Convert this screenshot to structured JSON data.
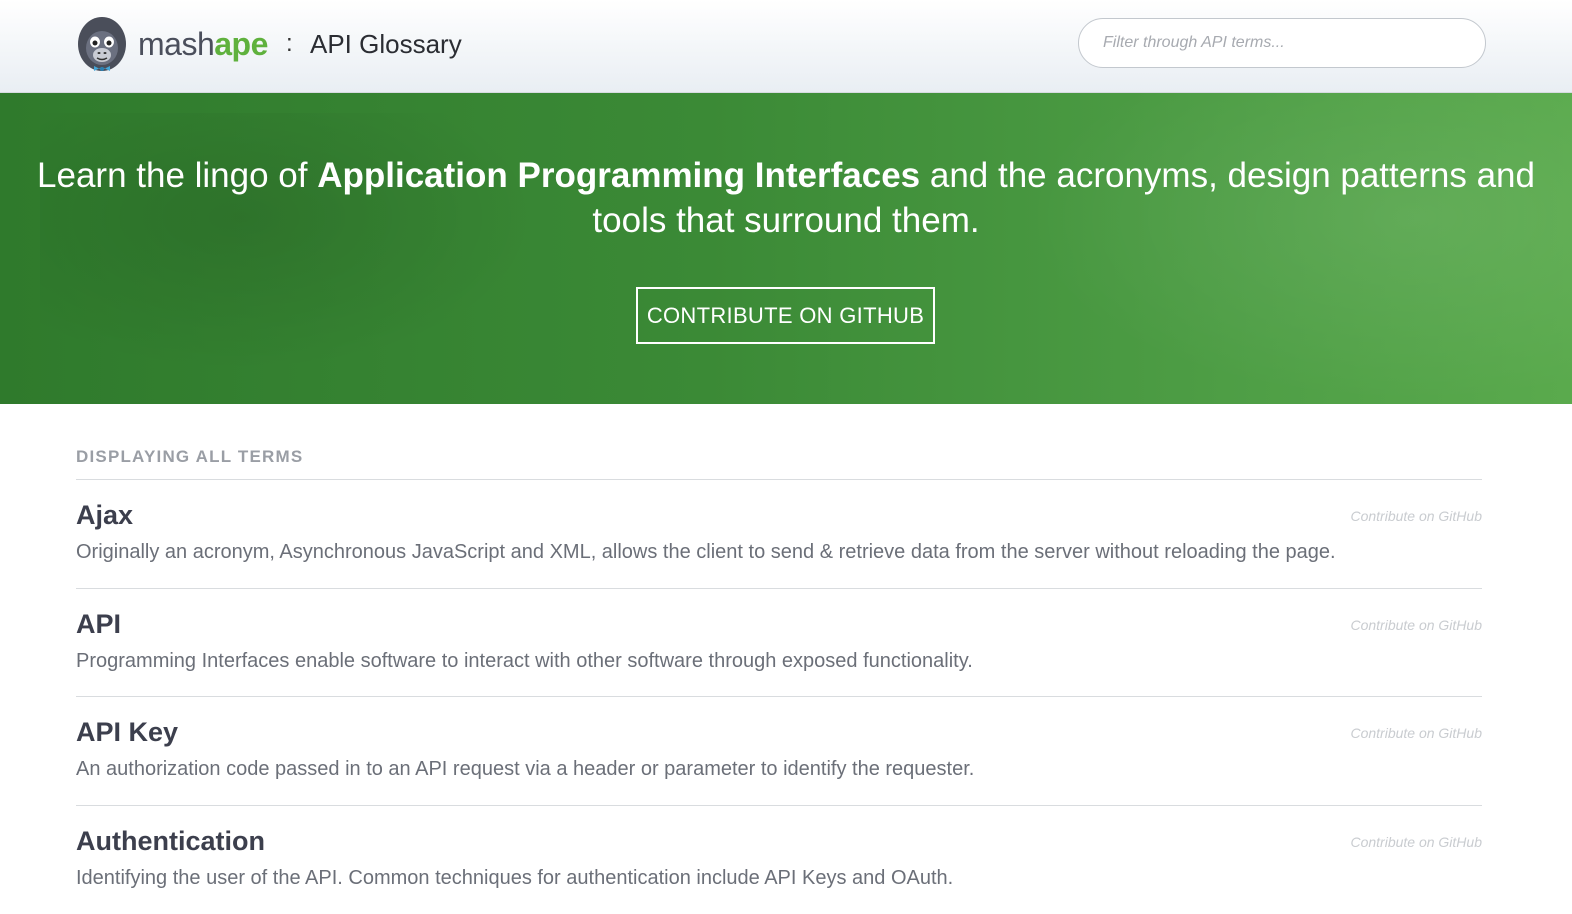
{
  "header": {
    "brand_mash": "mash",
    "brand_ape": "ape",
    "separator": ":",
    "title": "API Glossary",
    "search_placeholder": "Filter through API terms..."
  },
  "hero": {
    "text_before": "Learn the lingo of ",
    "text_bold": "Application Programming Interfaces",
    "text_after": " and the acronyms, design patterns and tools that surround them.",
    "button_label": "CONTRIBUTE ON GITHUB"
  },
  "list": {
    "heading": "DISPLAYING ALL TERMS",
    "terms": [
      {
        "name": "Ajax",
        "link": "Contribute on GitHub",
        "description": "Originally an acronym, Asynchronous JavaScript and XML, allows the client to send & retrieve data from the server without reloading the page."
      },
      {
        "name": "API",
        "link": "Contribute on GitHub",
        "description": "Programming Interfaces enable software to interact with other software through exposed functionality."
      },
      {
        "name": "API Key",
        "link": "Contribute on GitHub",
        "description": "An authorization code passed in to an API request via a header or parameter to identify the requester."
      },
      {
        "name": "Authentication",
        "link": "Contribute on GitHub",
        "description": "Identifying the user of the API. Common techniques for authentication include API Keys and OAuth."
      }
    ]
  },
  "colors": {
    "brand_green": "#5fb13d",
    "hero_green": "#3b8a36"
  },
  "icons": {
    "logo": "gorilla-mascot-icon"
  }
}
